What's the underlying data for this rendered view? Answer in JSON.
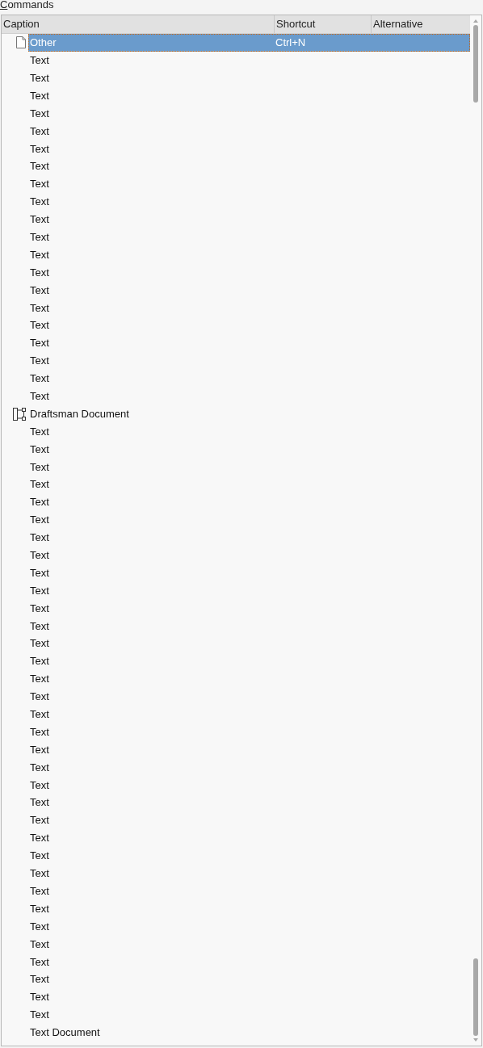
{
  "label": "Commands",
  "columns": [
    "Caption",
    "Shortcut",
    "Alternative"
  ],
  "rows": [
    {
      "caption": "Other",
      "kind": "document",
      "selected": true,
      "shortcut": "Ctrl+N",
      "children": [
        {
          "caption": "Text",
          "selected": false
        },
        {
          "caption": "Text",
          "selected": false
        },
        {
          "caption": "Text",
          "selected": false
        },
        {
          "caption": "Text",
          "selected": false
        },
        {
          "caption": "Text",
          "selected": false
        },
        {
          "caption": "Text",
          "selected": false
        },
        {
          "caption": "Text",
          "selected": false
        },
        {
          "caption": "Text",
          "selected": false
        },
        {
          "caption": "Text",
          "selected": false
        },
        {
          "caption": "Text",
          "selected": false
        },
        {
          "caption": "Text",
          "selected": false
        },
        {
          "caption": "Text",
          "selected": false
        },
        {
          "caption": "Text",
          "selected": false
        },
        {
          "caption": "Text",
          "selected": false
        },
        {
          "caption": "Text",
          "selected": false
        },
        {
          "caption": "Text",
          "selected": false
        },
        {
          "caption": "Text",
          "selected": false
        },
        {
          "caption": "Text",
          "selected": false
        },
        {
          "caption": "Text",
          "selected": false
        },
        {
          "caption": "Text",
          "selected": false
        }
      ]
    },
    {
      "caption": "Draftsman Document",
      "kind": "draftsman",
      "selected": false,
      "children": [
        {
          "caption": "Text",
          "selected": false
        },
        {
          "caption": "Text",
          "selected": false
        },
        {
          "caption": "Text",
          "selected": false
        },
        {
          "caption": "Text",
          "selected": false
        },
        {
          "caption": "Text",
          "selected": false
        },
        {
          "caption": "Text",
          "selected": false
        },
        {
          "caption": "Text",
          "selected": false
        },
        {
          "caption": "Text",
          "selected": false
        },
        {
          "caption": "Text",
          "selected": false
        },
        {
          "caption": "Text",
          "selected": false
        },
        {
          "caption": "Text",
          "selected": false
        },
        {
          "caption": "Text",
          "selected": false
        },
        {
          "caption": "Text",
          "selected": false
        },
        {
          "caption": "Text",
          "selected": false
        },
        {
          "caption": "Text",
          "selected": false
        },
        {
          "caption": "Text",
          "selected": false
        },
        {
          "caption": "Text",
          "selected": false
        },
        {
          "caption": "Text",
          "selected": false
        },
        {
          "caption": "Text",
          "selected": false
        },
        {
          "caption": "Text",
          "selected": false
        },
        {
          "caption": "Text",
          "selected": false
        },
        {
          "caption": "Text",
          "selected": false
        },
        {
          "caption": "Text",
          "selected": false
        },
        {
          "caption": "Text",
          "selected": false
        },
        {
          "caption": "Text",
          "selected": false
        },
        {
          "caption": "Text",
          "selected": false
        },
        {
          "caption": "Text",
          "selected": false
        },
        {
          "caption": "Text",
          "selected": false
        },
        {
          "caption": "Text",
          "selected": false
        },
        {
          "caption": "Text",
          "selected": false
        },
        {
          "caption": "Text",
          "selected": false
        },
        {
          "caption": "Text",
          "selected": false
        },
        {
          "caption": "Text",
          "selected": false
        },
        {
          "caption": "Text",
          "selected": false
        }
      ]
    },
    {
      "caption": "Text Document",
      "kind": "plain",
      "selected": false
    }
  ]
}
